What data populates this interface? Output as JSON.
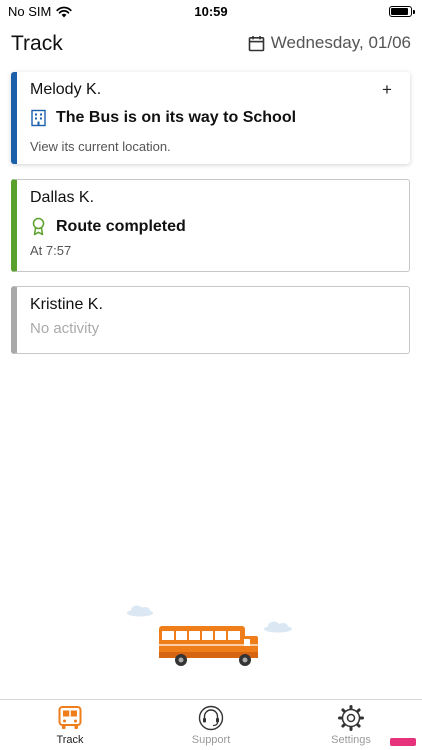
{
  "status_bar": {
    "carrier": "No SIM",
    "time": "10:59",
    "battery_level": 0.9
  },
  "header": {
    "title": "Track",
    "date": "Wednesday, 01/06"
  },
  "riders": [
    {
      "name": "Melody K.",
      "status": "The Bus is on its way to School",
      "subtext": "View its current location.",
      "accent": "#1b5fab",
      "status_icon": "school-building-icon",
      "action": "+"
    },
    {
      "name": "Dallas K.",
      "status": "Route completed",
      "subtext": "At 7:57",
      "accent": "#5aa02c",
      "status_icon": "award-ribbon-icon"
    },
    {
      "name": "Kristine K.",
      "status": "",
      "subtext": "No activity",
      "accent": "#a9a9a9"
    }
  ],
  "tabs": [
    {
      "label": "Track",
      "icon": "bus-icon",
      "selected": true,
      "color": "#ef7d1a"
    },
    {
      "label": "Support",
      "icon": "headset-icon",
      "selected": false
    },
    {
      "label": "Settings",
      "icon": "gear-icon",
      "selected": false
    }
  ],
  "colors": {
    "brand_orange": "#ef7d1a",
    "active_blue": "#1b5fab",
    "complete_green": "#5aa02c",
    "inactive_gray": "#a9a9a9"
  }
}
